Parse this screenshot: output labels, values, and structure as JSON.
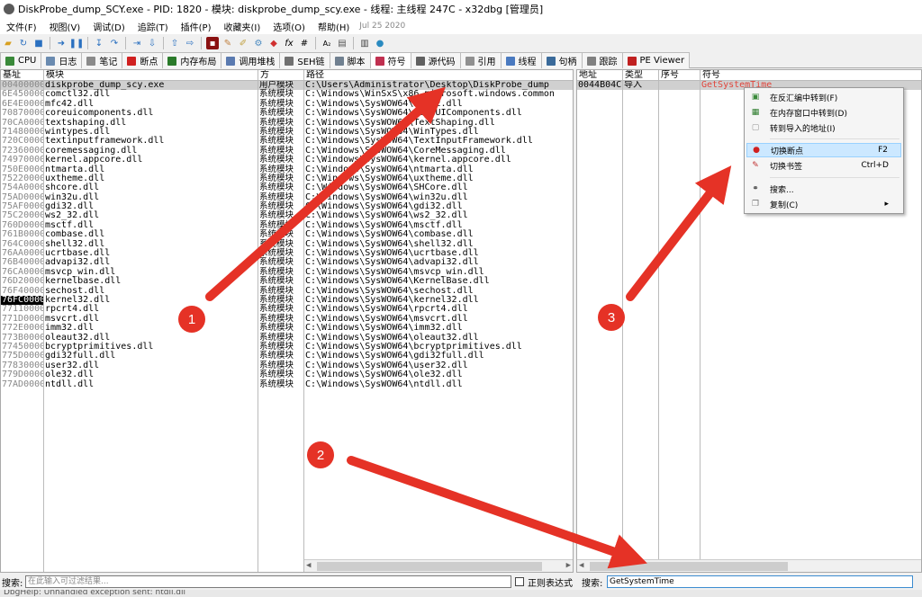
{
  "window": {
    "title": "DiskProbe_dump_SCY.exe - PID: 1820 - 模块: diskprobe_dump_scy.exe - 线程: 主线程 247C - x32dbg [管理员]"
  },
  "menu": {
    "items": [
      "文件(F)",
      "视图(V)",
      "调试(D)",
      "追踪(T)",
      "插件(P)",
      "收藏夹(I)",
      "选项(O)",
      "帮助(H)"
    ],
    "date": "Jul 25 2020"
  },
  "tabs": [
    {
      "label": "CPU",
      "icon": "cpu-icon",
      "color": "#3a8a3a"
    },
    {
      "label": "日志",
      "icon": "log-icon",
      "color": "#6a8bb0"
    },
    {
      "label": "笔记",
      "icon": "notes-icon",
      "color": "#8a8a8a"
    },
    {
      "label": "断点",
      "icon": "breakpoint-icon",
      "color": "#d02020"
    },
    {
      "label": "内存布局",
      "icon": "memory-icon",
      "color": "#2a7a2a"
    },
    {
      "label": "调用堆栈",
      "icon": "callstack-icon",
      "color": "#5a7ab0"
    },
    {
      "label": "SEH链",
      "icon": "seh-icon",
      "color": "#707070"
    },
    {
      "label": "脚本",
      "icon": "script-icon",
      "color": "#708090"
    },
    {
      "label": "符号",
      "icon": "symbol-icon",
      "color": "#c03050"
    },
    {
      "label": "源代码",
      "icon": "source-icon",
      "color": "#606060"
    },
    {
      "label": "引用",
      "icon": "references-icon",
      "color": "#909090"
    },
    {
      "label": "线程",
      "icon": "threads-icon",
      "color": "#4a7ac0"
    },
    {
      "label": "句柄",
      "icon": "handles-icon",
      "color": "#3a6a9a"
    },
    {
      "label": "跟踪",
      "icon": "trace-icon",
      "color": "#808080"
    },
    {
      "label": "PE Viewer",
      "icon": "pe-viewer-icon",
      "color": "#c02020"
    }
  ],
  "modules": {
    "headers": {
      "base": "基址",
      "module": "模块",
      "party": "方",
      "path": "路径"
    },
    "rows": [
      {
        "base": "00400000",
        "module": "diskprobe_dump_scy.exe",
        "party": "用户模块",
        "path": "C:\\Users\\Administrator\\Desktop\\DiskProbe_dump"
      },
      {
        "base": "6E450000",
        "module": "comctl32.dll",
        "party": "系统模块",
        "path": "C:\\Windows\\WinSxS\\x86_microsoft.windows.common"
      },
      {
        "base": "6E4E0000",
        "module": "mfc42.dll",
        "party": "系统模块",
        "path": "C:\\Windows\\SysWOW64\\mfc42.dll"
      },
      {
        "base": "70870000",
        "module": "coreuicomponents.dll",
        "party": "系统模块",
        "path": "C:\\Windows\\SysWOW64\\CoreUIComponents.dll"
      },
      {
        "base": "70CA0000",
        "module": "textshaping.dll",
        "party": "系统模块",
        "path": "C:\\Windows\\SysWOW64\\TextShaping.dll"
      },
      {
        "base": "71480000",
        "module": "wintypes.dll",
        "party": "系统模块",
        "path": "C:\\Windows\\SysWOW64\\WinTypes.dll"
      },
      {
        "base": "720C0000",
        "module": "textinputframework.dll",
        "party": "系统模块",
        "path": "C:\\Windows\\SysWOW64\\TextInputFramework.dll"
      },
      {
        "base": "72360000",
        "module": "coremessaging.dll",
        "party": "系统模块",
        "path": "C:\\Windows\\SysWOW64\\CoreMessaging.dll"
      },
      {
        "base": "74970000",
        "module": "kernel.appcore.dll",
        "party": "系统模块",
        "path": "C:\\Windows\\SysWOW64\\kernel.appcore.dll"
      },
      {
        "base": "750E0000",
        "module": "ntmarta.dll",
        "party": "系统模块",
        "path": "C:\\Windows\\SysWOW64\\ntmarta.dll"
      },
      {
        "base": "75220000",
        "module": "uxtheme.dll",
        "party": "系统模块",
        "path": "C:\\Windows\\SysWOW64\\uxtheme.dll"
      },
      {
        "base": "754A0000",
        "module": "shcore.dll",
        "party": "系统模块",
        "path": "C:\\Windows\\SysWOW64\\SHCore.dll"
      },
      {
        "base": "75AD0000",
        "module": "win32u.dll",
        "party": "系统模块",
        "path": "C:\\Windows\\SysWOW64\\win32u.dll"
      },
      {
        "base": "75AF0000",
        "module": "gdi32.dll",
        "party": "系统模块",
        "path": "C:\\Windows\\SysWOW64\\gdi32.dll"
      },
      {
        "base": "75C20000",
        "module": "ws2_32.dll",
        "party": "系统模块",
        "path": "C:\\Windows\\SysWOW64\\ws2_32.dll"
      },
      {
        "base": "760D0000",
        "module": "msctf.dll",
        "party": "系统模块",
        "path": "C:\\Windows\\SysWOW64\\msctf.dll"
      },
      {
        "base": "761B0000",
        "module": "combase.dll",
        "party": "系统模块",
        "path": "C:\\Windows\\SysWOW64\\combase.dll"
      },
      {
        "base": "764C0000",
        "module": "shell32.dll",
        "party": "系统模块",
        "path": "C:\\Windows\\SysWOW64\\shell32.dll"
      },
      {
        "base": "76AA0000",
        "module": "ucrtbase.dll",
        "party": "系统模块",
        "path": "C:\\Windows\\SysWOW64\\ucrtbase.dll"
      },
      {
        "base": "76B40000",
        "module": "advapi32.dll",
        "party": "系统模块",
        "path": "C:\\Windows\\SysWOW64\\advapi32.dll"
      },
      {
        "base": "76CA0000",
        "module": "msvcp_win.dll",
        "party": "系统模块",
        "path": "C:\\Windows\\SysWOW64\\msvcp_win.dll"
      },
      {
        "base": "76D20000",
        "module": "kernelbase.dll",
        "party": "系统模块",
        "path": "C:\\Windows\\SysWOW64\\KernelBase.dll"
      },
      {
        "base": "76F40000",
        "module": "sechost.dll",
        "party": "系统模块",
        "path": "C:\\Windows\\SysWOW64\\sechost.dll"
      },
      {
        "base": "76FC0000",
        "module": "kernel32.dll",
        "party": "系统模块",
        "path": "C:\\Windows\\SysWOW64\\kernel32.dll",
        "highlight": true
      },
      {
        "base": "77110000",
        "module": "rpcrt4.dll",
        "party": "系统模块",
        "path": "C:\\Windows\\SysWOW64\\rpcrt4.dll"
      },
      {
        "base": "771D0000",
        "module": "msvcrt.dll",
        "party": "系统模块",
        "path": "C:\\Windows\\SysWOW64\\msvcrt.dll"
      },
      {
        "base": "772E0000",
        "module": "imm32.dll",
        "party": "系统模块",
        "path": "C:\\Windows\\SysWOW64\\imm32.dll"
      },
      {
        "base": "773B0000",
        "module": "oleaut32.dll",
        "party": "系统模块",
        "path": "C:\\Windows\\SysWOW64\\oleaut32.dll"
      },
      {
        "base": "77450000",
        "module": "bcryptprimitives.dll",
        "party": "系统模块",
        "path": "C:\\Windows\\SysWOW64\\bcryptprimitives.dll"
      },
      {
        "base": "775D0000",
        "module": "gdi32full.dll",
        "party": "系统模块",
        "path": "C:\\Windows\\SysWOW64\\gdi32full.dll"
      },
      {
        "base": "77830000",
        "module": "user32.dll",
        "party": "系统模块",
        "path": "C:\\Windows\\SysWOW64\\user32.dll"
      },
      {
        "base": "779D0000",
        "module": "ole32.dll",
        "party": "系统模块",
        "path": "C:\\Windows\\SysWOW64\\ole32.dll"
      },
      {
        "base": "77AD0000",
        "module": "ntdll.dll",
        "party": "系统模块",
        "path": "C:\\Windows\\SysWOW64\\ntdll.dll"
      }
    ]
  },
  "symbols": {
    "headers": {
      "address": "地址",
      "type": "类型",
      "ordinal": "序号",
      "symbol": "符号"
    },
    "rows": [
      {
        "address": "0044B04C",
        "type": "导入",
        "ordinal": "",
        "symbol": "GetSystemTime",
        "color": "#e0463c"
      }
    ]
  },
  "context_menu": {
    "items": [
      {
        "label": "在反汇编中转到(F)",
        "shortcut": "",
        "icon": "disassembly-icon",
        "selected": false
      },
      {
        "label": "在内存窗口中转到(D)",
        "shortcut": "",
        "icon": "dump-icon",
        "selected": false
      },
      {
        "label": "转到导入的地址(I)",
        "shortcut": "",
        "icon": "import-address-icon",
        "selected": false
      },
      {
        "label": "切换断点",
        "shortcut": "F2",
        "icon": "breakpoint-icon",
        "selected": true
      },
      {
        "label": "切换书签",
        "shortcut": "Ctrl+D",
        "icon": "bookmark-icon",
        "selected": false
      },
      {
        "label": "搜索...",
        "shortcut": "",
        "icon": "binoculars-icon",
        "selected": false
      },
      {
        "label": "复制(C)",
        "shortcut": "▸",
        "icon": "copy-icon",
        "selected": false
      }
    ]
  },
  "bottom": {
    "search_label": "搜索:",
    "module_filter_placeholder": "在此输入可过滤结果...",
    "regex_label": "正则表达式",
    "symbol_search_label": "搜索:",
    "symbol_search_value": "GetSystemTime"
  },
  "status": {
    "text": "DbgHelp: Unhandled exception sent: ntdll.dll"
  },
  "annotations": {
    "badges": [
      "1",
      "2",
      "3"
    ],
    "arrow_color": "#e53226"
  }
}
